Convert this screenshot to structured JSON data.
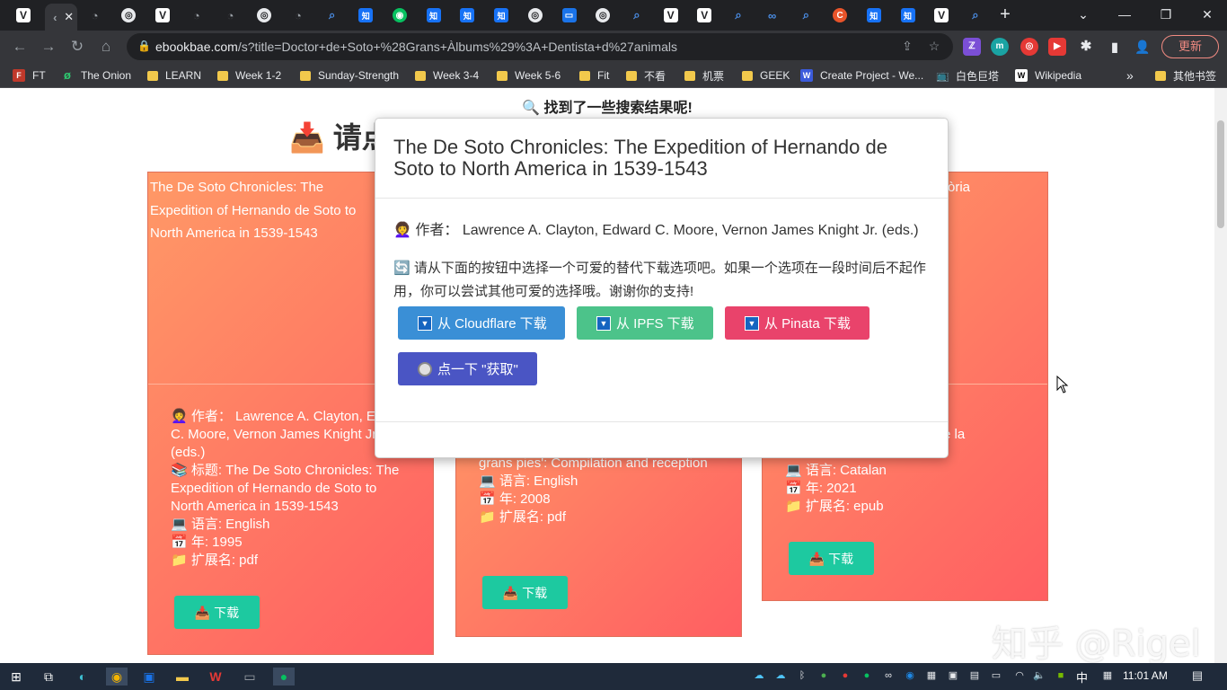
{
  "browser": {
    "tabs": [
      {
        "icon": "V",
        "kind": "v"
      },
      {
        "icon": "‹",
        "kind": "active"
      },
      {
        "icon": "ghost",
        "kind": "ghost"
      },
      {
        "icon": "globe",
        "kind": "globe"
      },
      {
        "icon": "V",
        "kind": "v"
      },
      {
        "icon": "ghost",
        "kind": "ghost"
      },
      {
        "icon": "ghost",
        "kind": "ghost"
      },
      {
        "icon": "globe",
        "kind": "globe"
      },
      {
        "icon": "ghost",
        "kind": "ghost"
      },
      {
        "icon": "search",
        "kind": "mag"
      },
      {
        "icon": "知",
        "kind": "zhi"
      },
      {
        "icon": "wechat",
        "kind": "wx"
      },
      {
        "icon": "知",
        "kind": "zhi"
      },
      {
        "icon": "知",
        "kind": "zhi"
      },
      {
        "icon": "知",
        "kind": "zhi"
      },
      {
        "icon": "globe",
        "kind": "globe"
      },
      {
        "icon": "bilibili",
        "kind": "bil"
      },
      {
        "icon": "globe",
        "kind": "globe"
      },
      {
        "icon": "search",
        "kind": "mag"
      },
      {
        "icon": "V",
        "kind": "v"
      },
      {
        "icon": "V",
        "kind": "v"
      },
      {
        "icon": "search",
        "kind": "mag"
      },
      {
        "icon": "∞",
        "kind": "mag"
      },
      {
        "icon": "search",
        "kind": "mag"
      },
      {
        "icon": "C",
        "kind": "red"
      },
      {
        "icon": "知",
        "kind": "zhi"
      },
      {
        "icon": "知",
        "kind": "zhi"
      },
      {
        "icon": "V",
        "kind": "v"
      },
      {
        "icon": "search",
        "kind": "mag"
      }
    ],
    "new_tab": "+",
    "url_host": "ebookbae.com",
    "url_path": "/s?title=Doctor+de+Soto+%28Grans+Àlbums%29%3A+Dentista+d%27animals",
    "update_label": "更新",
    "bookmarks": [
      {
        "label": "FT",
        "icon": "ft"
      },
      {
        "label": "The Onion",
        "icon": "onion"
      },
      {
        "label": "LEARN",
        "icon": "folder"
      },
      {
        "label": "Week 1-2",
        "icon": "folder"
      },
      {
        "label": "Sunday-Strength",
        "icon": "folder"
      },
      {
        "label": "Week 3-4",
        "icon": "folder"
      },
      {
        "label": "Week 5-6",
        "icon": "folder"
      },
      {
        "label": "Fit",
        "icon": "folder"
      },
      {
        "label": "不看",
        "icon": "folder"
      },
      {
        "label": "机票",
        "icon": "folder"
      },
      {
        "label": "GEEK",
        "icon": "folder"
      },
      {
        "label": "Create Project - We...",
        "icon": "w"
      },
      {
        "label": "白色巨塔",
        "icon": "tv"
      },
      {
        "label": "Wikipedia",
        "icon": "wiki"
      }
    ],
    "bookmarks_more": "»",
    "other_bookmarks": "其他书签"
  },
  "page": {
    "found_text": "🔍 找到了一些搜索结果呢!",
    "heading": "📥 请点",
    "cards": [
      {
        "img_alt": "The De Soto Chronicles: The Expedition of Hernando de Soto to North America in 1539-1543",
        "author": "👩‍🦱 作者： Lawrence A. Clayton, Edward C. Moore, Vernon James Knight Jr. (eds.)",
        "title": "📚 标题: The De Soto Chronicles: The Expedition of Hernando de Soto to North America in 1539-1543",
        "language": "💻 语言: English",
        "year": "📅 年: 1995",
        "ext": "📁 扩展名: pdf",
        "download": "📥 下载"
      },
      {
        "partial": "g",
        "title_tail": "grans pies': Compilation and reception",
        "language": "💻 语言: English",
        "year": "📅 年: 2008",
        "ext": "📁 扩展名: pdf",
        "download": "📥 下载"
      },
      {
        "img_alt": "òria",
        "author_tail1": "ré",
        "author_tail2": "s de la",
        "language": "💻 语言: Catalan",
        "year": "📅 年: 2021",
        "ext": "📁 扩展名: epub",
        "download": "📥 下载"
      }
    ]
  },
  "modal": {
    "title": "The De Soto Chronicles: The Expedition of Hernando de Soto to North America in 1539-1543",
    "author": "👩‍🦱 作者： Lawrence A. Clayton, Edward C. Moore, Vernon James Knight Jr. (eds.)",
    "message": "🔄 请从下面的按钮中选择一个可爱的替代下载选项吧。如果一个选项在一段时间后不起作用，你可以尝试其他可爱的选择哦。谢谢你的支持!",
    "buttons": {
      "cloudflare": "从 Cloudflare 下载",
      "ipfs": "从 IPFS 下载",
      "pinata": "从 Pinata 下载",
      "get": "点一下 \"获取\""
    },
    "colors": {
      "cloudflare": "#3a8fd6",
      "ipfs": "#4cc38a",
      "pinata": "#e9436b",
      "get": "#4a55c4"
    }
  },
  "watermark": "知乎 @Rigel",
  "taskbar": {
    "ime": "中",
    "time": "11:01 AM"
  }
}
